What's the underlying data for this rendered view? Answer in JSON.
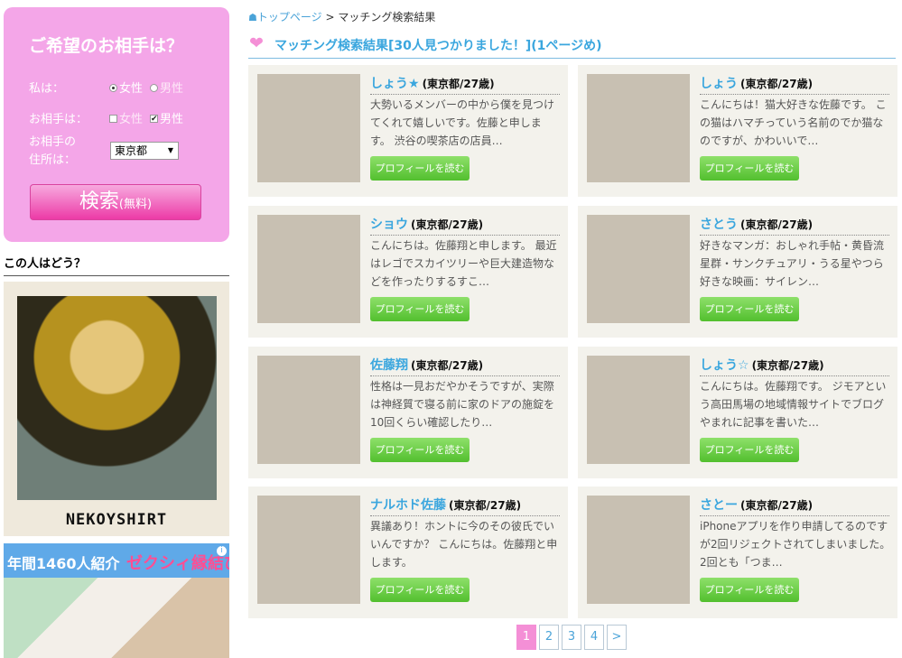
{
  "search": {
    "title": "ご希望のお相手は？",
    "self_label": "私は：",
    "self_options": [
      {
        "label": "女性",
        "selected": true
      },
      {
        "label": "男性",
        "selected": false
      }
    ],
    "partner_label": "お相手は：",
    "partner_options": [
      {
        "label": "女性",
        "checked": false
      },
      {
        "label": "男性",
        "checked": true
      }
    ],
    "address_label_line1": "お相手の",
    "address_label_line2": "住所は：",
    "address_value": "東京都",
    "button_main": "検索",
    "button_sub": "(無料)"
  },
  "who": {
    "title": "この人はどう？",
    "signature": "NEKOYSHIRT"
  },
  "ad": {
    "text": "年間1460人紹介",
    "brand": "ゼクシィ縁結び",
    "info_icon": "info-icon"
  },
  "breadcrumb": {
    "home": "トップページ",
    "separator": ">",
    "current": "マッチング検索結果"
  },
  "results": {
    "heading": "マッチング検索結果[30人見つかりました！](1ページめ)"
  },
  "cards": [
    {
      "name": "しょう★",
      "meta": "(東京都/27歳)",
      "desc": "大勢いるメンバーの中から僕を見つけてくれて嬉しいです。佐藤と申します。 渋谷の喫茶店の店員…",
      "button": "プロフィールを読む"
    },
    {
      "name": "しょう",
      "meta": "(東京都/27歳)",
      "desc": "こんにちは！猫大好きな佐藤です。 この猫はハマチっていう名前のでか猫なのですが、かわいいで…",
      "button": "プロフィールを読む"
    },
    {
      "name": "ショウ",
      "meta": "(東京都/27歳)",
      "desc": "こんにちは。佐藤翔と申します。 最近はレゴでスカイツリーや巨大建造物などを作ったりするすこ…",
      "button": "プロフィールを読む"
    },
    {
      "name": "さとう",
      "meta": "(東京都/27歳)",
      "desc": "好きなマンガ：おしゃれ手帖・黄昏流星群・サンクチュアリ・うる星やつら 好きな映画：サイレン…",
      "button": "プロフィールを読む"
    },
    {
      "name": "佐藤翔",
      "meta": "(東京都/27歳)",
      "desc": "性格は一見おだやかそうですが、実際は神経質で寝る前に家のドアの施錠を10回くらい確認したり…",
      "button": "プロフィールを読む"
    },
    {
      "name": "しょう☆",
      "meta": "(東京都/27歳)",
      "desc": "こんにちは。佐藤翔です。 ジモアという高田馬場の地域情報サイトでブログやまれに記事を書いた…",
      "button": "プロフィールを読む"
    },
    {
      "name": "ナルホド佐藤",
      "meta": "(東京都/27歳)",
      "desc": "異議あり！ホントに今のその彼氏でいいんですか？ こんにちは。佐藤翔と申します。",
      "button": "プロフィールを読む"
    },
    {
      "name": "さとー",
      "meta": "(東京都/27歳)",
      "desc": "iPhoneアプリを作り申請してるのですが2回リジェクトされてしまいました。2回とも「つま…",
      "button": "プロフィールを読む"
    }
  ],
  "pager": {
    "pages": [
      "1",
      "2",
      "3",
      "4"
    ],
    "active": "1",
    "next": ">"
  }
}
